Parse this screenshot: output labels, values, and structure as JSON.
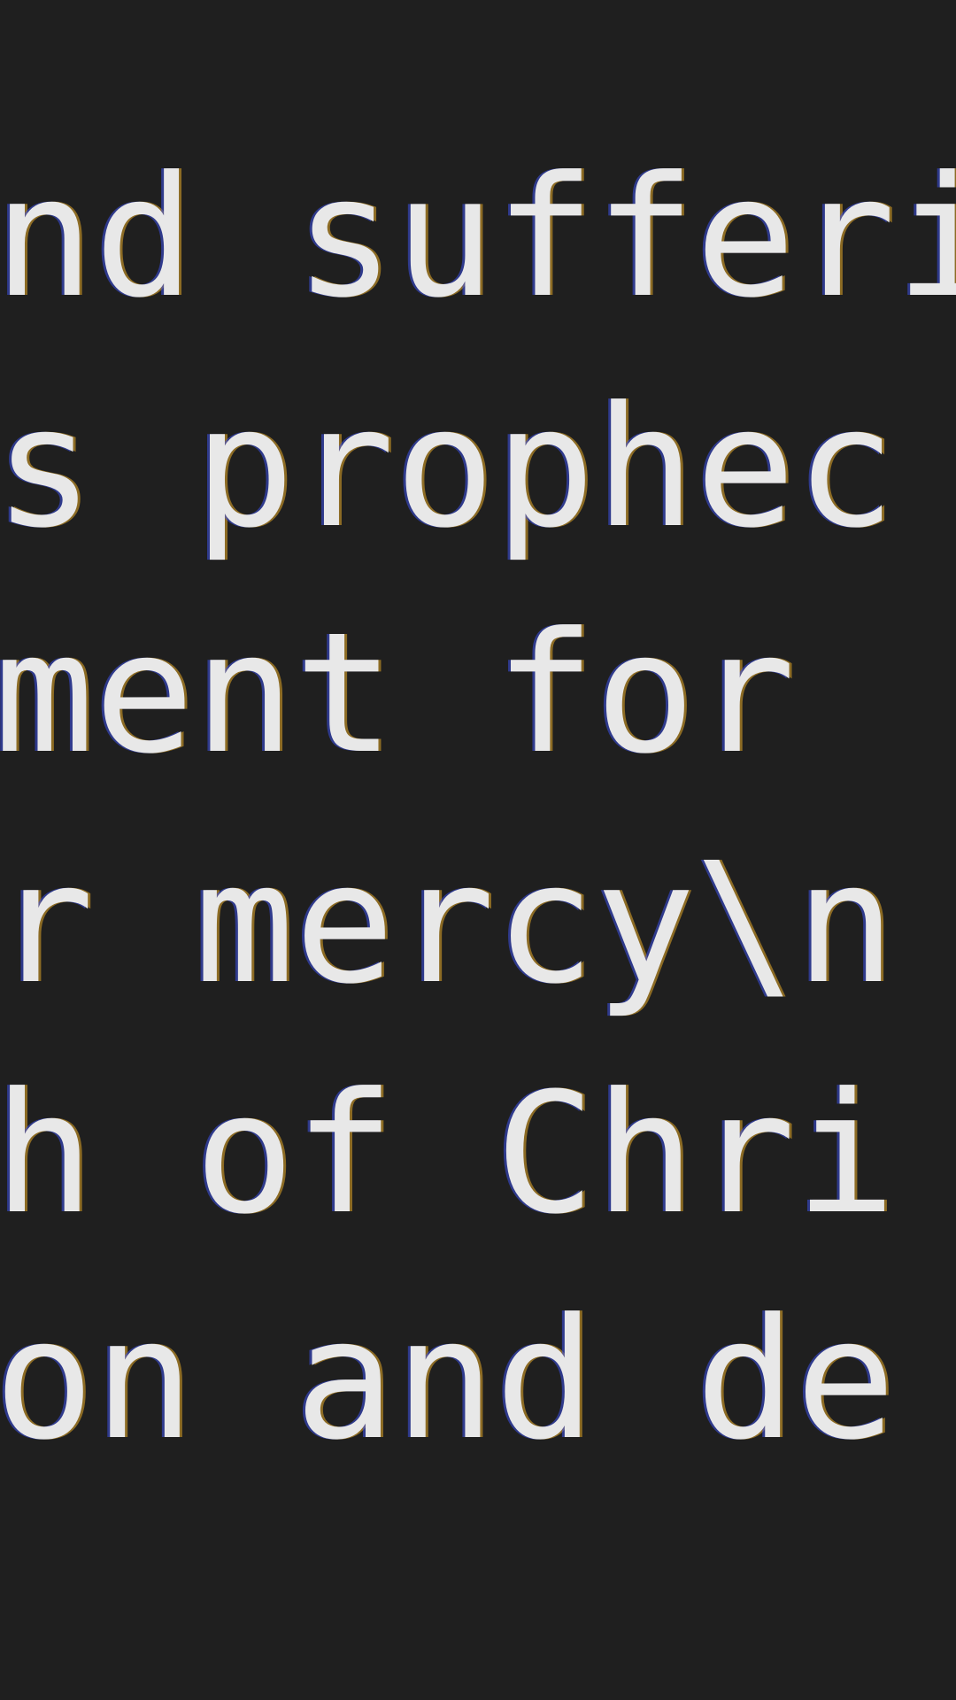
{
  "editor": {
    "lines": [
      "and sufferi",
      "’s prophec",
      "rment for ",
      "or mercy\\n",
      "th of Chri",
      "ion and de"
    ]
  }
}
